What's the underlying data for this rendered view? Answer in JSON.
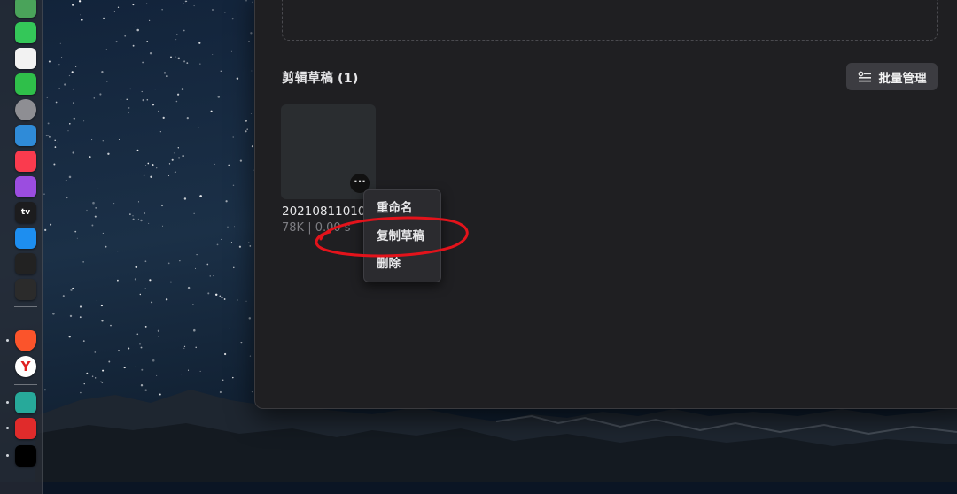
{
  "dock": {
    "items": [
      {
        "icon": "maps-icon",
        "color": "#4aa35a"
      },
      {
        "icon": "messages-icon",
        "color": "#34c759"
      },
      {
        "icon": "photos-icon",
        "color": "#f2f2f2"
      },
      {
        "icon": "facetime-icon",
        "color": "#2fbf4a"
      },
      {
        "icon": "system-preferences-icon",
        "color": "#8e8e93"
      },
      {
        "icon": "keynote-icon",
        "color": "#2f8bd8"
      },
      {
        "icon": "music-icon",
        "color": "#fa3b4e"
      },
      {
        "icon": "podcasts-icon",
        "color": "#9b4de0"
      },
      {
        "icon": "apple-tv-icon",
        "color": "#1c1c1e",
        "label": "tv"
      },
      {
        "icon": "app-store-icon",
        "color": "#1d8ef0"
      },
      {
        "icon": "terminal-icon",
        "color": "#222"
      },
      {
        "icon": "activity-monitor-icon",
        "color": "#2b2b2b"
      },
      {
        "icon": "brave-browser-icon",
        "color": "#fb542b"
      },
      {
        "icon": "yandex-browser-icon",
        "color": "#ffffff",
        "label": "Y"
      },
      {
        "icon": "teal-app-icon",
        "color": "#27a99a"
      },
      {
        "icon": "netease-music-icon",
        "color": "#e02b2b"
      },
      {
        "icon": "capcut-icon",
        "color": "#000000"
      }
    ]
  },
  "drafts": {
    "section_title": "剪辑草稿 (1)",
    "batch_manage_label": "批量管理",
    "item": {
      "name": "202108110101",
      "meta": "78K | 0.00 s",
      "more_label": "···"
    }
  },
  "context_menu": {
    "items": [
      "重命名",
      "复制草稿",
      "删除"
    ]
  },
  "annotation": {
    "color": "#e3131b",
    "highlighted_item": "复制草稿"
  }
}
